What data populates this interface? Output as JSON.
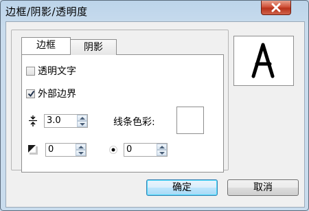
{
  "window": {
    "title": "边框/阴影/透明度"
  },
  "tabs": [
    {
      "label": "边框",
      "active": true
    },
    {
      "label": "阴影",
      "active": false
    }
  ],
  "options": {
    "transparent_text": {
      "label": "透明文字",
      "checked": false
    },
    "outer_border": {
      "label": "外部边界",
      "checked": true
    }
  },
  "line_width": {
    "value": "3.0",
    "icon": "line-spacing-icon"
  },
  "line_color": {
    "label": "线条色彩:",
    "color": "#ffffff"
  },
  "shadow_offset": {
    "value": "0",
    "icon": "shadow-square-icon"
  },
  "dot_size": {
    "value": "0",
    "icon": "dot-icon"
  },
  "preview": {
    "glyph": "A"
  },
  "buttons": {
    "ok": "确定",
    "cancel": "取消"
  }
}
